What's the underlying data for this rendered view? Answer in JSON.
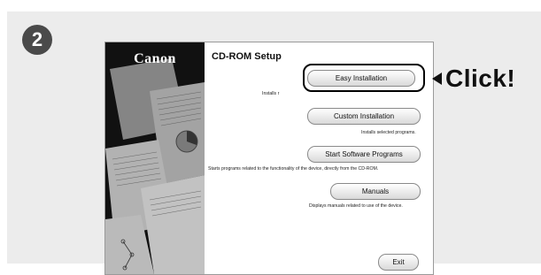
{
  "step": {
    "number": "2"
  },
  "window": {
    "brand": "Canon",
    "title": "CD-ROM Setup",
    "buttons": {
      "easy_installation": "Easy Installation",
      "custom_installation": "Custom Installation",
      "start_software_programs": "Start Software Programs",
      "manuals": "Manuals",
      "exit": "Exit"
    },
    "descriptions": {
      "easy_installation": "Installs r",
      "custom_installation": "Installs selected programs.",
      "start_software_programs": "Starts programs related to the functionality of the device, directly from the CD-ROM.",
      "manuals": "Displays manuals related to use of the device."
    }
  },
  "callout": {
    "label": "Click!"
  },
  "colors": {
    "panel": "#ececec",
    "badge": "#4a4a4a",
    "art_bg": "#111111"
  }
}
